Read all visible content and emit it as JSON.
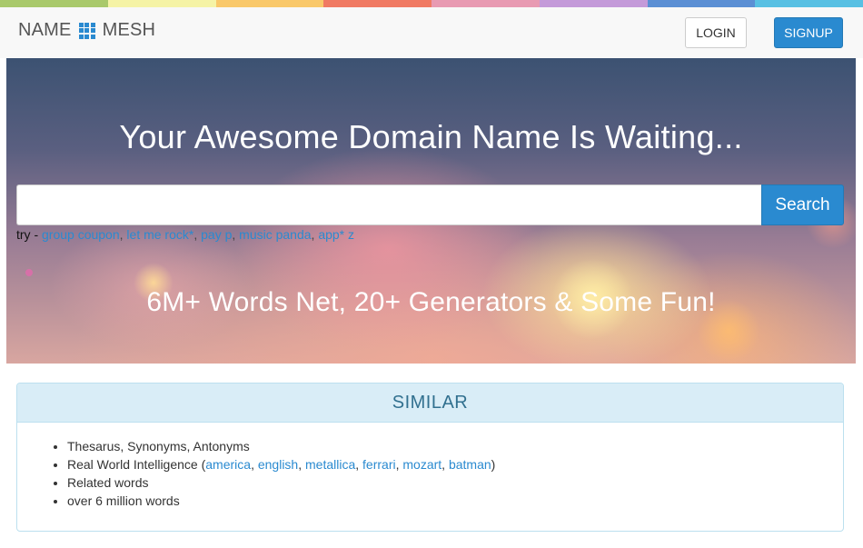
{
  "colorbar": [
    "#a9c96b",
    "#f5f3a6",
    "#f9c86a",
    "#f07a63",
    "#e89ab2",
    "#c49ad9",
    "#5b8fd4",
    "#58c0e3"
  ],
  "navbar": {
    "brand_left": "NAME",
    "brand_right": "MESH",
    "login_label": "LOGIN",
    "signup_label": "SIGNUP"
  },
  "hero": {
    "title": "Your Awesome Domain Name Is Waiting...",
    "search_value": "",
    "search_button": "Search",
    "try_label": "try - ",
    "try_links": [
      "group coupon",
      "let me rock*",
      "pay p",
      "music panda",
      "app* z"
    ],
    "subtitle": "6M+ Words Net, 20+ Generators & Some Fun!"
  },
  "similar": {
    "heading": "SIMILAR",
    "item1": "Thesarus, Synonyms, Antonyms",
    "item2_prefix": "Real World Intelligence (",
    "item2_links": [
      "america",
      "english",
      "metallica",
      "ferrari",
      "mozart",
      "batman"
    ],
    "item2_suffix": ")",
    "item3": "Related words",
    "item4": "over 6 million words"
  },
  "colors": {
    "accent": "#2a8ad0",
    "panel_heading": "#31708f",
    "panel_bg": "#d9edf7"
  }
}
